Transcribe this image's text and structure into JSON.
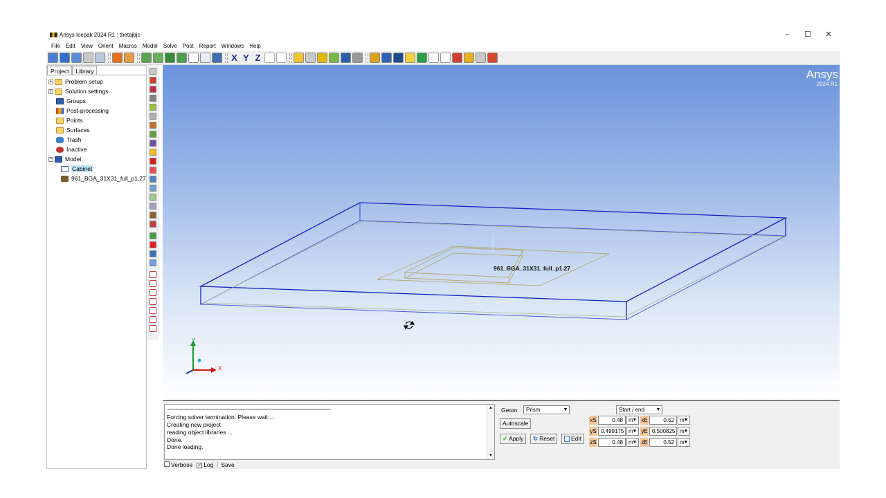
{
  "window": {
    "title": "Ansys Icepak 2024 R1 : thetajbjc",
    "minimize": "–",
    "maximize": "☐",
    "close": "✕"
  },
  "menu": [
    "File",
    "Edit",
    "View",
    "Orient",
    "Macros",
    "Model",
    "Solve",
    "Post",
    "Report",
    "Windows",
    "Help"
  ],
  "toolbar": {
    "axis_x": "X",
    "axis_y": "Y",
    "axis_z": "Z"
  },
  "tabs": {
    "project": "Project",
    "library": "Library"
  },
  "tree": {
    "problem_setup": "Problem setup",
    "solution_settings": "Solution settings",
    "groups": "Groups",
    "post_processing": "Post-processing",
    "points": "Points",
    "surfaces": "Surfaces",
    "trash": "Trash",
    "inactive": "Inactive",
    "model": "Model",
    "cabinet": "Cabinet",
    "bga": "961_BGA_31X31_full_p1.27"
  },
  "brand": {
    "name": "Ansys",
    "version": "2024 R1"
  },
  "viewport": {
    "object_label": "961_BGA_31X31_full_p1.27",
    "triad_y": "Y",
    "triad_x": "X"
  },
  "messages": [
    "Forcing solver termination.  Please wait ...",
    "Creating new project",
    "reading object libraries ...",
    "Done.",
    "Done loading."
  ],
  "log": {
    "verbose": "Verbose",
    "log": "Log",
    "save": "Save"
  },
  "geom": {
    "label": "Geom",
    "type": "Prism",
    "spec": "Start / end",
    "autoscale": "Autoscale",
    "apply": "Apply",
    "reset": "Reset",
    "edit": "Edit",
    "xS_label": "xS",
    "xS": "0.48",
    "xS_unit": "m",
    "xE_label": "xE",
    "xE": "0.52",
    "xE_unit": "m",
    "yS_label": "yS",
    "yS": "0.499175",
    "yS_unit": "m",
    "yE_label": "yE",
    "yE": "0.500825",
    "yE_unit": "m",
    "zS_label": "zS",
    "zS": "0.48",
    "zS_unit": "m",
    "zE_label": "zE",
    "zE": "0.52",
    "zE_unit": "m"
  },
  "colors": {
    "cabinet_edges": "#1420c0",
    "viewport_top": "#6b93dc",
    "viewport_bottom": "#ffffff",
    "coord_label_bg": "#f5c59a"
  }
}
